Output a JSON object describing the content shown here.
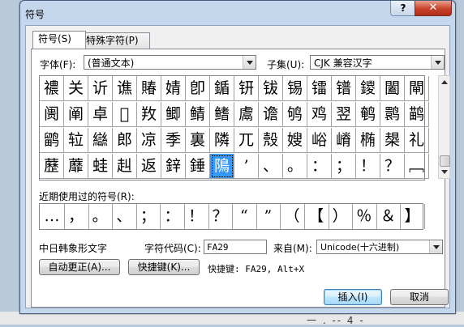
{
  "dialog": {
    "title": "符号",
    "help_label": "?",
    "close_label": "✕"
  },
  "tabs": [
    {
      "label": "符号(S)"
    },
    {
      "label": "特殊字符(P)"
    }
  ],
  "font": {
    "label": "字体(F):",
    "value": "(普通文本)"
  },
  "subset": {
    "label": "子集(U):",
    "value": "CJK 兼容汉字"
  },
  "grid_rows": [
    [
      "禯",
      "关",
      "䜣",
      "谯",
      "賰",
      "婧",
      "卽",
      "鍎",
      "钘",
      "钹",
      "锡",
      "镭",
      "镨",
      "鑁",
      "闔",
      "閘"
    ],
    [
      "阓",
      "阐",
      "卓",
      "𫝀",
      "䍩",
      "鲫",
      "鲭",
      "鳍",
      "鬳",
      "谵",
      "鸲",
      "鸡",
      "翌",
      "鹌",
      "鹮",
      "鹋"
    ],
    [
      "鹠",
      "䢂",
      "䜌",
      "郎",
      "凉",
      "季",
      "裏",
      "隣",
      "兀",
      "殼",
      "嫂",
      "峪",
      "嵴",
      "椭",
      "槼",
      "礼"
    ],
    [
      "藶",
      "蘼",
      "蛙",
      "赳",
      "返",
      "鋅",
      "錘",
      "隝",
      "’",
      "、",
      "。",
      "：",
      "；",
      "！",
      "？",
      "﹇"
    ]
  ],
  "recent": {
    "label": "近期使用过的符号(R):",
    "symbols": [
      "…",
      "，",
      "。",
      "、",
      "；",
      "：",
      "！",
      "？",
      "“",
      "”",
      "（",
      "【",
      "）",
      "％",
      "＆",
      "】"
    ]
  },
  "char_name": "中日韩象形文字",
  "char_code": {
    "label": "字符代码(C):",
    "value": "FA29"
  },
  "from": {
    "label": "来自(M):",
    "value": "Unicode(十六进制)"
  },
  "buttons": {
    "autocorrect": "自动更正(A)...",
    "shortcut_key": "快捷键(K)...",
    "insert": "插入(I)",
    "cancel": "取消"
  },
  "shortcut_text": "快捷键: FA29, Alt+X",
  "background_text": "一 . -- 4 -"
}
